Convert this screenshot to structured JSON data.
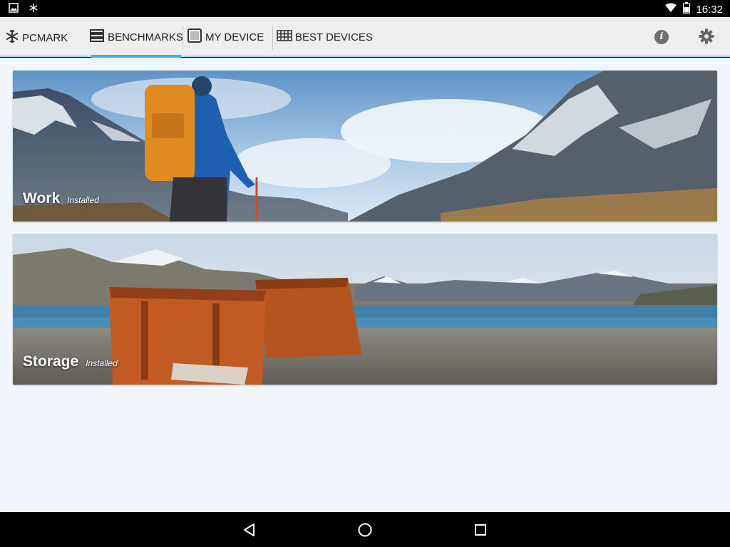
{
  "status_bar": {
    "time": "16:32",
    "left_icons": [
      "image-icon",
      "snowflake-icon"
    ],
    "right_icons": [
      "wifi-icon",
      "battery-icon"
    ]
  },
  "app_bar": {
    "brand": "PCMARK",
    "tabs": [
      {
        "label": "BENCHMARKS",
        "icon": "list-icon",
        "active": true
      },
      {
        "label": "MY DEVICE",
        "icon": "tablet-icon",
        "active": false
      },
      {
        "label": "BEST DEVICES",
        "icon": "grid-icon",
        "active": false
      }
    ],
    "actions": [
      "info-icon",
      "gear-icon"
    ],
    "accent_color": "#2fb8e8"
  },
  "benchmarks": [
    {
      "title": "Work",
      "status": "Installed"
    },
    {
      "title": "Storage",
      "status": "Installed"
    }
  ],
  "nav_bar": [
    "back-icon",
    "home-icon",
    "recents-icon"
  ]
}
